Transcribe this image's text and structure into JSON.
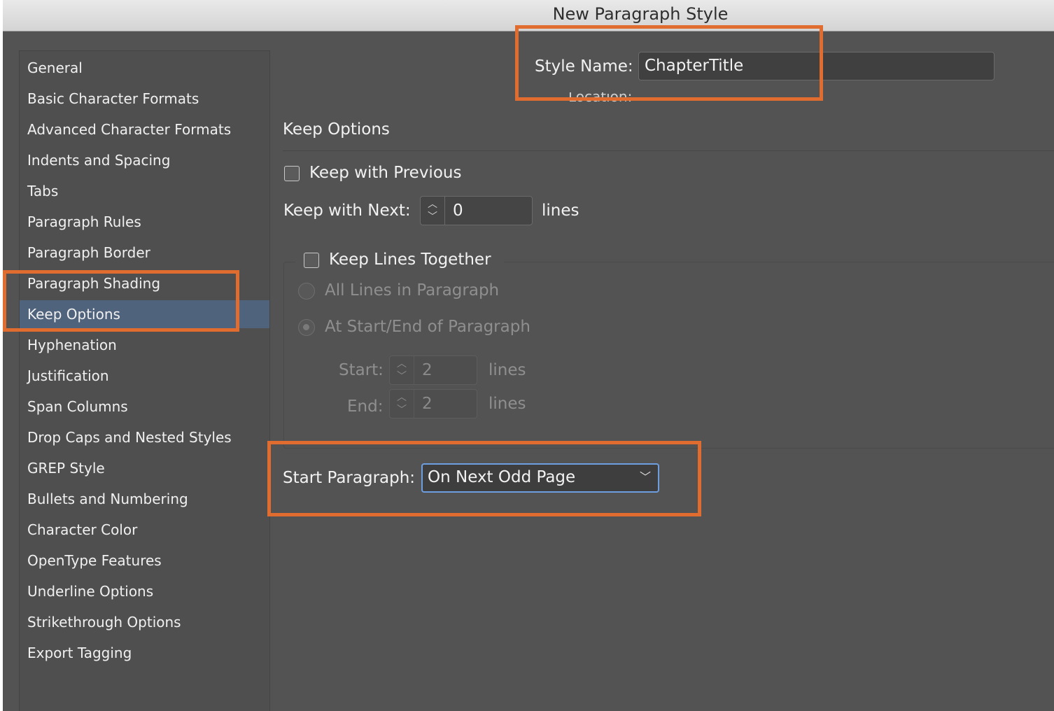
{
  "window": {
    "title": "New Paragraph Style"
  },
  "sidebar": {
    "items": [
      {
        "label": "General"
      },
      {
        "label": "Basic Character Formats"
      },
      {
        "label": "Advanced Character Formats"
      },
      {
        "label": "Indents and Spacing"
      },
      {
        "label": "Tabs"
      },
      {
        "label": "Paragraph Rules"
      },
      {
        "label": "Paragraph Border"
      },
      {
        "label": "Paragraph Shading"
      },
      {
        "label": "Keep Options",
        "selected": true
      },
      {
        "label": "Hyphenation"
      },
      {
        "label": "Justification"
      },
      {
        "label": "Span Columns"
      },
      {
        "label": "Drop Caps and Nested Styles"
      },
      {
        "label": "GREP Style"
      },
      {
        "label": "Bullets and Numbering"
      },
      {
        "label": "Character Color"
      },
      {
        "label": "OpenType Features"
      },
      {
        "label": "Underline Options"
      },
      {
        "label": "Strikethrough Options"
      },
      {
        "label": "Export Tagging"
      }
    ]
  },
  "header": {
    "style_name_label": "Style Name:",
    "style_name_value": "ChapterTitle",
    "location_label": "Location:"
  },
  "keep_options": {
    "section_title": "Keep Options",
    "keep_with_previous": {
      "label": "Keep with Previous",
      "checked": false
    },
    "keep_with_next": {
      "label": "Keep with Next:",
      "value": "0",
      "unit": "lines"
    },
    "keep_lines_together": {
      "label": "Keep Lines Together",
      "checked": false,
      "all_lines": {
        "label": "All Lines in Paragraph",
        "selected": false
      },
      "start_end": {
        "label": "At Start/End of Paragraph",
        "selected": true
      },
      "start": {
        "label": "Start:",
        "value": "2",
        "unit": "lines"
      },
      "end": {
        "label": "End:",
        "value": "2",
        "unit": "lines"
      }
    },
    "start_paragraph": {
      "label": "Start Paragraph:",
      "value": "On Next Odd Page"
    }
  },
  "icons": {
    "up": "chevron-up-icon",
    "down": "chevron-down-icon"
  },
  "colors": {
    "highlight": "#e06c30",
    "selection": "#50637d",
    "dialog_bg": "#535353",
    "focus_ring": "#6d9fe0"
  }
}
